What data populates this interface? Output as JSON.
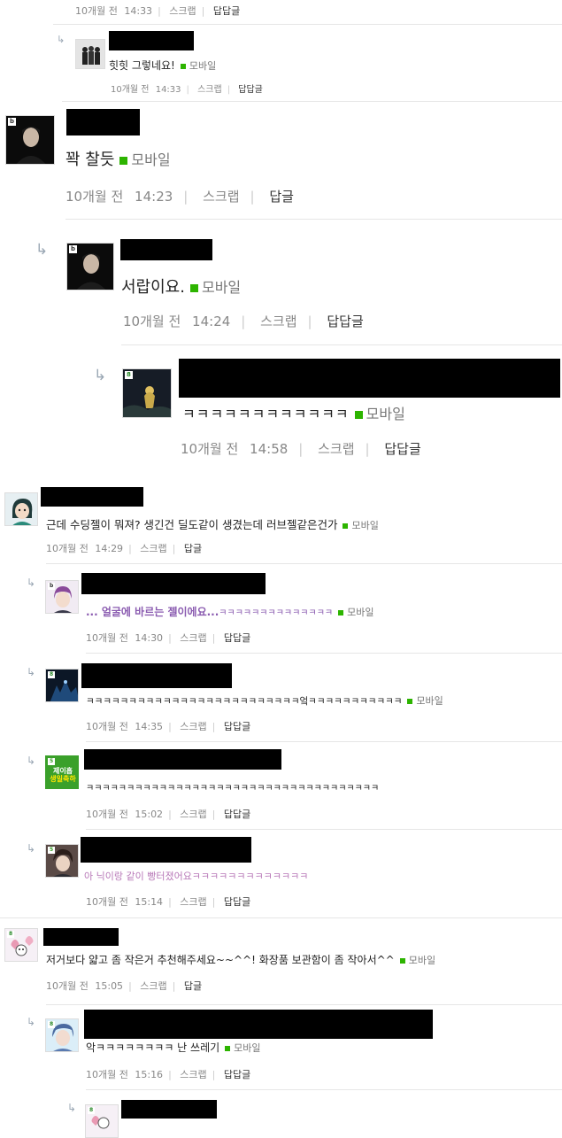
{
  "meta_labels": {
    "scrap": "스크랩",
    "reply": "답글",
    "reply_reply": "답답글"
  },
  "comments": [
    {
      "date": "10개월 전",
      "time": "14:33"
    },
    {
      "text": "힛힛 그렇네요!",
      "mobile": "모바일",
      "date": "10개월 전",
      "time": "14:33"
    },
    {
      "text": "꽉 찰듯",
      "mobile": "모바일",
      "date": "10개월 전",
      "time": "14:23"
    },
    {
      "text": "서랍이요.",
      "mobile": "모바일",
      "date": "10개월 전",
      "time": "14:24"
    },
    {
      "text": "ㅋㅋㅋㅋㅋㅋㅋㅋㅋㅋㅋㅋ",
      "mobile": "모바일",
      "date": "10개월 전",
      "time": "14:58"
    },
    {
      "text": "근데 수딩젤이 뭐져? 생긴건 딜도같이 생겼는데 러브젤같은건가",
      "mobile": "모바일",
      "date": "10개월 전",
      "time": "14:29"
    },
    {
      "text_a": "... 얼굴에 바르는 젤이에요...",
      "text_b": "ㅋㅋㅋㅋㅋㅋㅋㅋㅋㅋㅋㅋㅋㅋ",
      "mobile": "모바일",
      "date": "10개월 전",
      "time": "14:30"
    },
    {
      "text": "ㅋㅋㅋㅋㅋㅋㅋㅋㅋㅋㅋㅋㅋㅋㅋㅋㅋㅋㅋㅋㅋㅋㅋㅋㅋ엌ㅋㅋㅋㅋㅋㅋㅋㅋㅋㅋㅋ",
      "mobile": "모바일",
      "date": "10개월 전",
      "time": "14:35"
    },
    {
      "text": "ㅋㅋㅋㅋㅋㅋㅋㅋㅋㅋㅋㅋㅋㅋㅋㅋㅋㅋㅋㅋㅋㅋㅋㅋㅋㅋㅋㅋㅋㅋㅋㅋㅋㅋㅋㅋ",
      "date": "10개월 전",
      "time": "15:02"
    },
    {
      "text": "아 닉이랑 같이 빵터졌어요ㅋㅋㅋㅋㅋㅋㅋㅋㅋㅋㅋㅋㅋ",
      "date": "10개월 전",
      "time": "15:14"
    },
    {
      "text": "저거보다 얇고 좀 작은거 추천해주세요~~^^! 화장품 보관함이 좀 작아서^^",
      "mobile": "모바일",
      "date": "10개월 전",
      "time": "15:05"
    },
    {
      "text": "악ㅋㅋㅋㅋㅋㅋㅋㅋ 난 쓰레기",
      "mobile": "모바일",
      "date": "10개월 전",
      "time": "15:16"
    }
  ],
  "avatar_badges": {
    "b": "b",
    "eight": "8",
    "five": "5",
    "green_banner_line1": "제이홉",
    "green_banner_line2": "생일축하"
  },
  "colors": {
    "mobile_green": "#2db400",
    "purple_text": "#8a5bb0",
    "pink_text": "#b879b8",
    "meta_gray": "#888888"
  }
}
